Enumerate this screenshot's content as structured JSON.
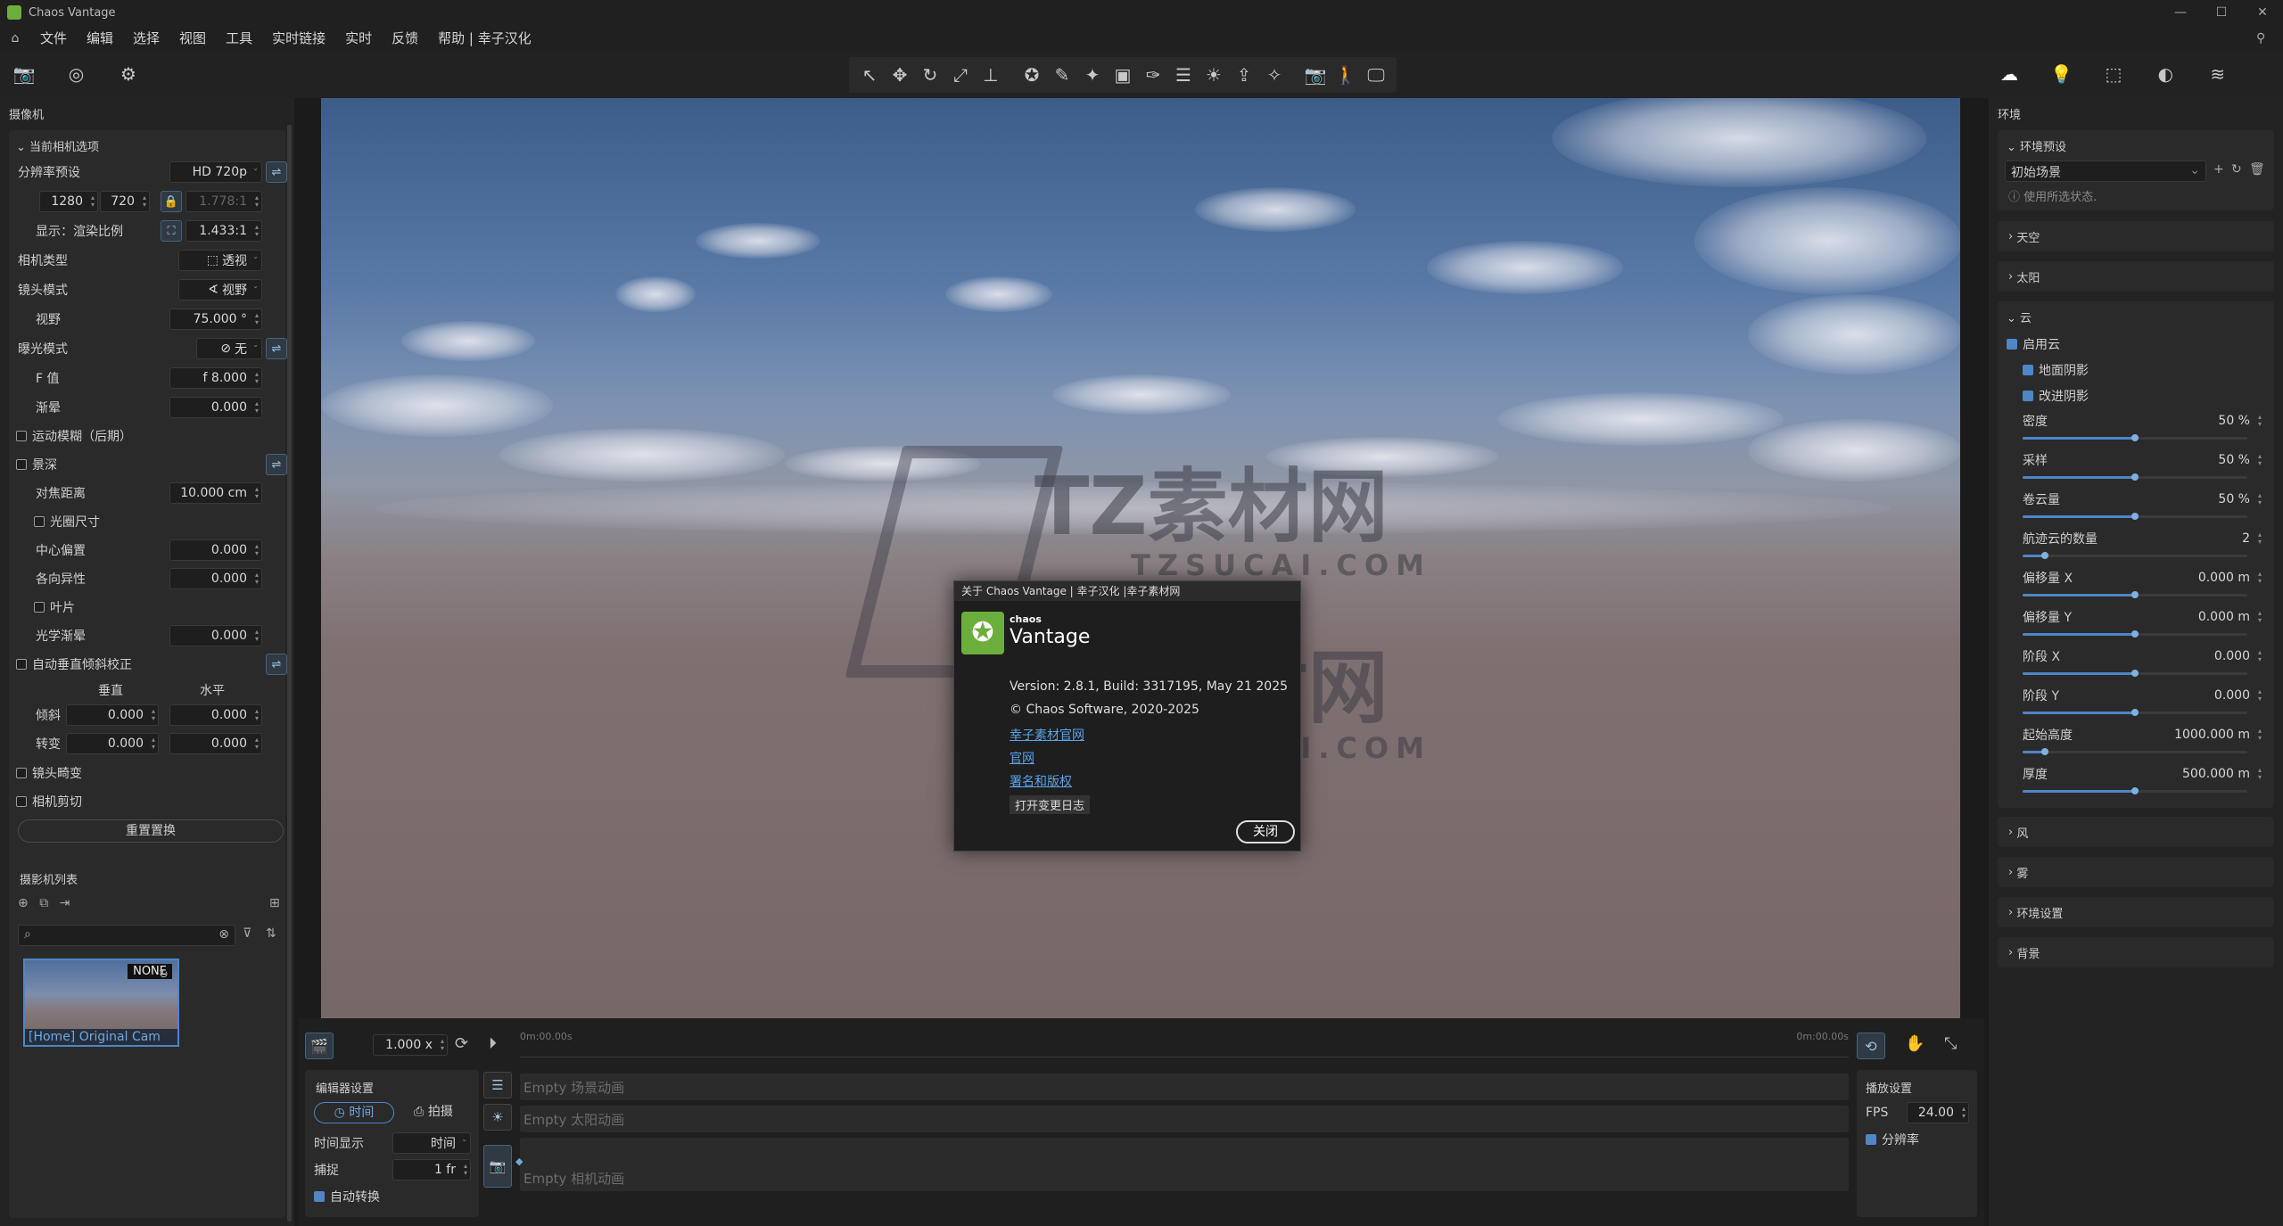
{
  "app": {
    "title": "Chaos Vantage"
  },
  "menu": [
    "文件",
    "编辑",
    "选择",
    "视图",
    "工具",
    "实时链接",
    "实时",
    "反馈",
    "帮助 | 幸子汉化"
  ],
  "left": {
    "header": "摄像机",
    "section": "当前相机选项",
    "resolution_label": "分辨率预设",
    "resolution_value": "HD 720p",
    "width": "1280",
    "height": "720",
    "ratio": "1.778:1",
    "display_label": "显示：渲染比例",
    "display_value": "1.433:1",
    "camera_type_label": "相机类型",
    "camera_type_value": "透视",
    "lens_label": "镜头模式",
    "lens_value": "视野",
    "fov_label": "视野",
    "fov_value": "75.000 °",
    "exposure_label": "曝光模式",
    "exposure_value": "无",
    "fstop_label": "F 值",
    "fstop_value": "f 8.000",
    "smear_label": "渐晕",
    "smear_value": "0.000",
    "motion_blur": "运动模糊（后期）",
    "dof": "景深",
    "focus_label": "对焦距离",
    "focus_value": "10.000 cm",
    "aperture": "光圈尺寸",
    "center_label": "中心偏置",
    "center_value": "0.000",
    "aniso_label": "各向异性",
    "aniso_value": "0.000",
    "blades": "叶片",
    "optical_label": "光学渐晕",
    "optical_value": "0.000",
    "auto_vert": "自动垂直倾斜校正",
    "vert_col": "垂直",
    "horiz_col": "水平",
    "tilt_label": "倾斜",
    "tilt_v": "0.000",
    "tilt_h": "0.000",
    "shift_label": "转变",
    "shift_v": "0.000",
    "shift_h": "0.000",
    "lens_distort": "镜头畸变",
    "clipping": "相机剪切",
    "reset_button": "重置置换",
    "camlist_header": "摄影机列表",
    "thumb_badge": "NONE",
    "thumb_label": "[Home] Original Cam"
  },
  "right": {
    "header": "环境",
    "preset_section": "环境预设",
    "preset_value": "初始场景",
    "preset_hint": "使用所选状态.",
    "sky": "天空",
    "sun": "太阳",
    "cloud_section": "云",
    "enable_clouds": "启用云",
    "ground_shadow": "地面阴影",
    "improved_shadow": "改进阴影",
    "sliders": [
      {
        "label": "密度",
        "value": "50 %",
        "fill": 0.5
      },
      {
        "label": "采样",
        "value": "50 %",
        "fill": 0.5
      },
      {
        "label": "卷云量",
        "value": "50 %",
        "fill": 0.5
      },
      {
        "label": "航迹云的数量",
        "value": "2",
        "fill": 0.1
      },
      {
        "label": "偏移量 X",
        "value": "0.000 m",
        "fill": 0.5
      },
      {
        "label": "偏移量 Y",
        "value": "0.000 m",
        "fill": 0.5
      },
      {
        "label": "阶段 X",
        "value": "0.000",
        "fill": 0.5
      },
      {
        "label": "阶段 Y",
        "value": "0.000",
        "fill": 0.5
      },
      {
        "label": "起始高度",
        "value": "1000.000 m",
        "fill": 0.1
      },
      {
        "label": "厚度",
        "value": "500.000 m",
        "fill": 0.5
      }
    ],
    "wind": "风",
    "fog": "雾",
    "env_settings": "环境设置",
    "background": "背景"
  },
  "dialog": {
    "title": "关于 Chaos Vantage | 幸子汉化 |幸子素材网",
    "brand_small": "chaos",
    "brand_big": "Vantage",
    "version": "Version: 2.8.1, Build: 3317195, May 21 2025",
    "copyright": "© Chaos Software, 2020-2025",
    "link1": "幸子素材官网",
    "link2": "官网",
    "link3": "署名和版权",
    "changelog": "打开变更日志",
    "close": "关闭"
  },
  "watermark": {
    "cn": "TZ素材网",
    "en": "TZSUCAI.COM"
  },
  "timeline": {
    "speed": "1.000 x",
    "time_start": "0m:00.00s",
    "time_end": "0m:00.00s",
    "editor_header": "编辑器设置",
    "time_btn": "时间",
    "capture_btn": "拍摄",
    "time_display_label": "时间显示",
    "time_display_value": "时间",
    "snap_label": "捕捉",
    "snap_value": "1 fr",
    "auto_convert": "自动转换",
    "track1": "Empty 场景动画",
    "track2": "Empty 太阳动画",
    "track3": "Empty 相机动画",
    "playback_header": "播放设置",
    "fps_label": "FPS",
    "fps_value": "24.00",
    "resolution_cb": "分辨率"
  }
}
